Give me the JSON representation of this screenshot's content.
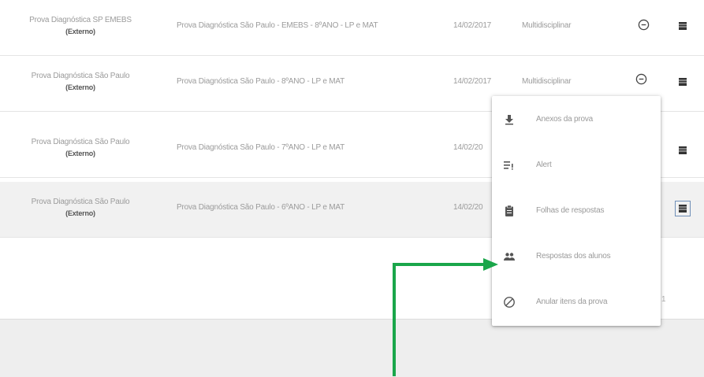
{
  "table": {
    "rows": [
      {
        "name": "Prova Diagnóstica SP EMEBS",
        "origin": "(Externo)",
        "description": "Prova Diagnóstica São Paulo - EMEBS - 8ºANO - LP e MAT",
        "date": "14/02/2017",
        "area": "Multidisciplinar"
      },
      {
        "name": "Prova Diagnóstica São Paulo",
        "origin": "(Externo)",
        "description": "Prova Diagnóstica São Paulo - 8ºANO - LP e MAT",
        "date": "14/02/2017",
        "area": "Multidisciplinar"
      },
      {
        "name": "Prova Diagnóstica São Paulo",
        "origin": "(Externo)",
        "description": "Prova Diagnóstica São Paulo - 7ºANO - LP e MAT",
        "date": "14/02/20",
        "area": ""
      },
      {
        "name": "Prova Diagnóstica São Paulo",
        "origin": "(Externo)",
        "description": "Prova Diagnóstica São Paulo - 6ºANO - LP e MAT",
        "date": "14/02/20",
        "area": ""
      }
    ]
  },
  "pager": {
    "text": "1"
  },
  "context_menu": {
    "items": [
      {
        "label": "Anexos da prova",
        "icon": "download-icon"
      },
      {
        "label": "Alert",
        "icon": "alert-list-icon"
      },
      {
        "label": "Folhas de respostas",
        "icon": "clipboard-icon"
      },
      {
        "label": "Respostas dos alunos",
        "icon": "people-icon"
      },
      {
        "label": "Anular itens da prova",
        "icon": "block-icon"
      }
    ]
  },
  "colors": {
    "row_highlight": "#f1f1f1",
    "arrow": "#1aa64a",
    "text_muted": "#9a9a9a",
    "footer": "#eeeeee"
  }
}
